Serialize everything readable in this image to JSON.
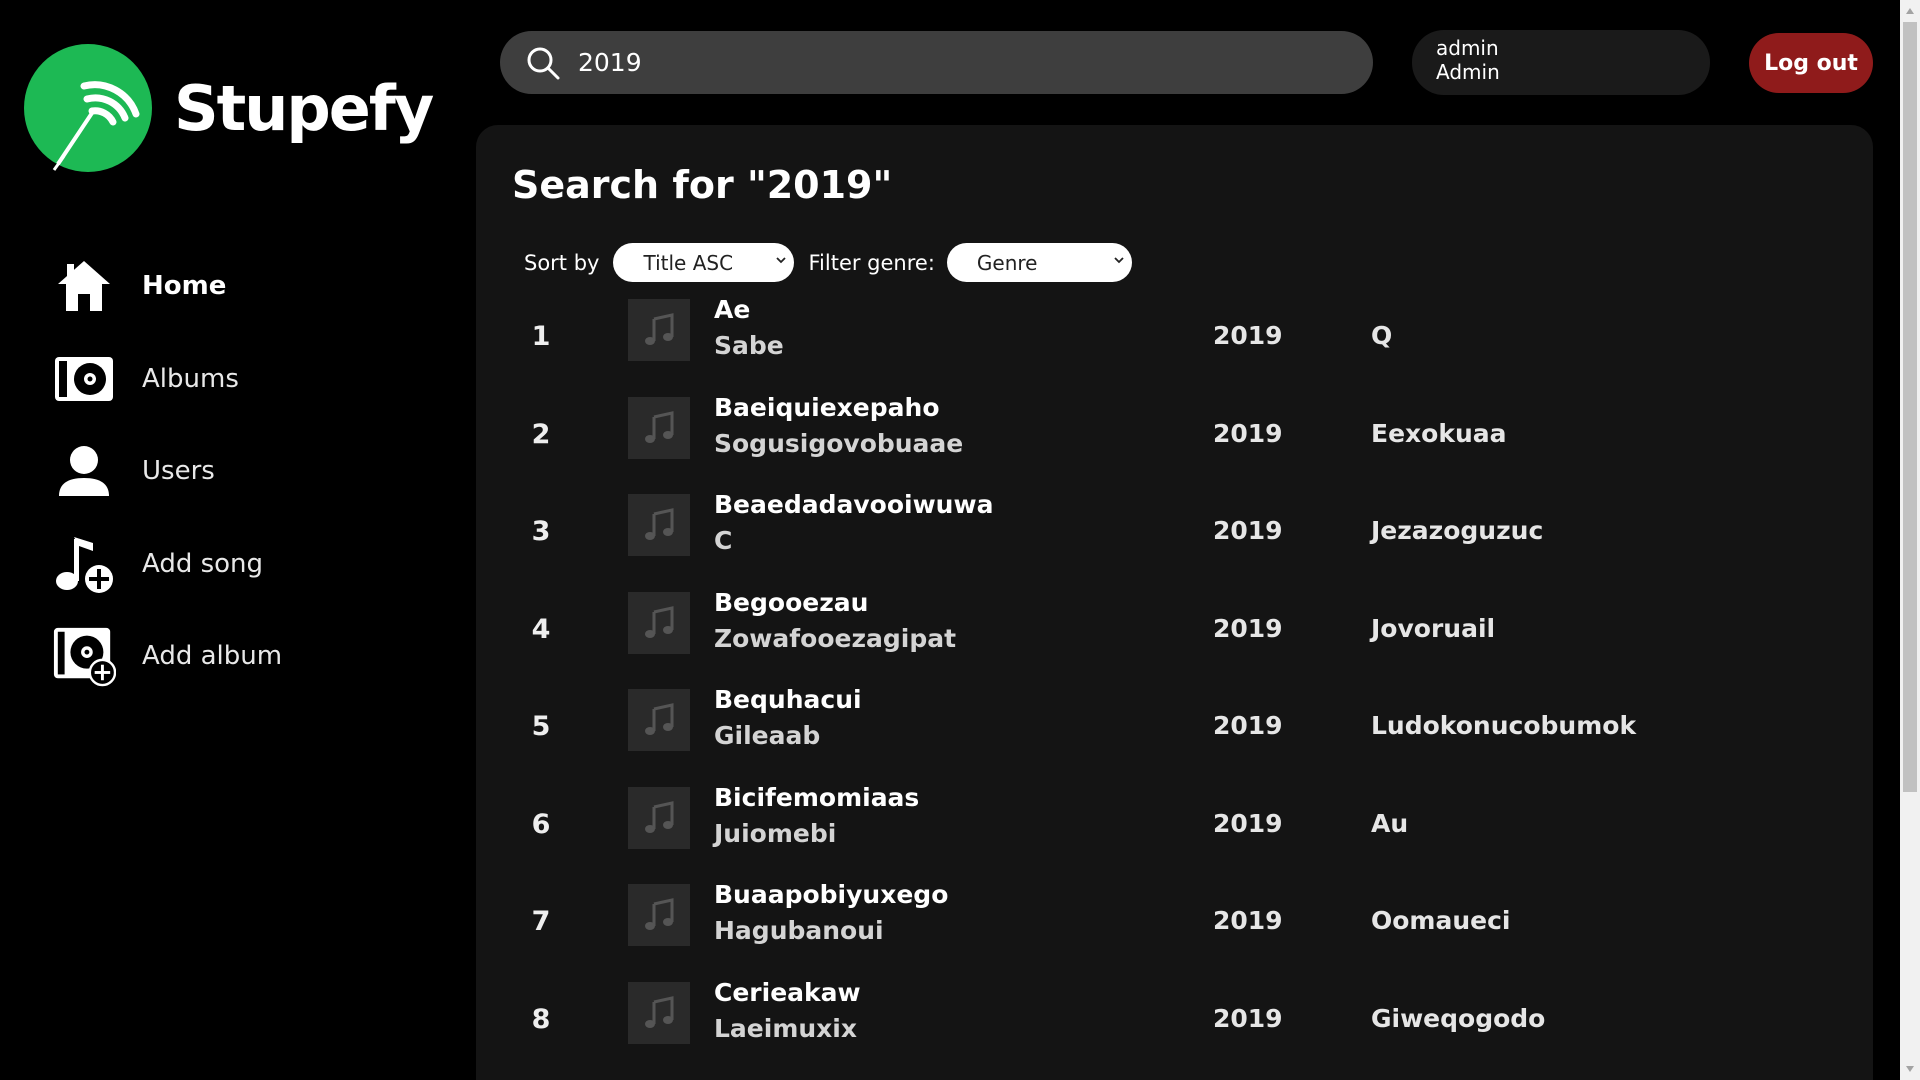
{
  "app": {
    "name": "Stupefy"
  },
  "sidebar": {
    "items": [
      {
        "label": "Home",
        "icon": "home-icon",
        "active": true
      },
      {
        "label": "Albums",
        "icon": "album-icon",
        "active": false
      },
      {
        "label": "Users",
        "icon": "user-icon",
        "active": false
      },
      {
        "label": "Add song",
        "icon": "add-song-icon",
        "active": false
      },
      {
        "label": "Add album",
        "icon": "add-album-icon",
        "active": false
      }
    ]
  },
  "header": {
    "search": {
      "value": "2019",
      "placeholder": ""
    },
    "user": {
      "username": "admin",
      "role": "Admin"
    },
    "logout_label": "Log out"
  },
  "main": {
    "title": "Search for \"2019\"",
    "sort_label": "Sort by",
    "sort_value": "Title ASC",
    "filter_label": "Filter genre:",
    "filter_value": "Genre",
    "songs": [
      {
        "num": "1",
        "title": "Ae",
        "artist": "Sabe",
        "year": "2019",
        "album": "Q"
      },
      {
        "num": "2",
        "title": "Baeiquiexepaho",
        "artist": "Sogusigovobuaae",
        "year": "2019",
        "album": "Eexokuaa"
      },
      {
        "num": "3",
        "title": "Beaedadavooiwuwa",
        "artist": "C",
        "year": "2019",
        "album": "Jezazoguzuc"
      },
      {
        "num": "4",
        "title": "Begooezau",
        "artist": "Zowafooezagipat",
        "year": "2019",
        "album": "Jovoruail"
      },
      {
        "num": "5",
        "title": "Bequhacui",
        "artist": "Gileaab",
        "year": "2019",
        "album": "Ludokonucobumok"
      },
      {
        "num": "6",
        "title": "Bicifemomiaas",
        "artist": "Juiomebi",
        "year": "2019",
        "album": "Au"
      },
      {
        "num": "7",
        "title": "Buaapobiyuxego",
        "artist": "Hagubanoui",
        "year": "2019",
        "album": "Oomaueci"
      },
      {
        "num": "8",
        "title": "Cerieakaw",
        "artist": "Laeimuxix",
        "year": "2019",
        "album": "Giweqogodo"
      }
    ]
  },
  "colors": {
    "brand": "#1db954",
    "logout": "#8f1b1b",
    "panel": "#141414",
    "search_bg": "#3e3e3e"
  }
}
